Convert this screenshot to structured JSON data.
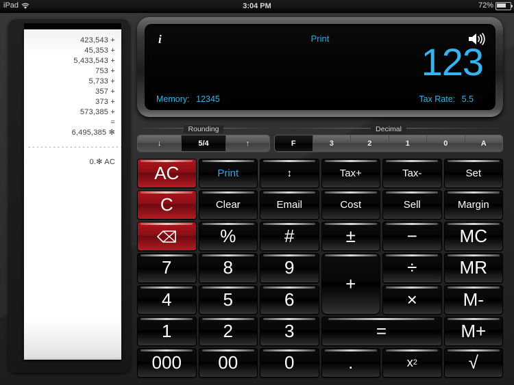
{
  "status_bar": {
    "carrier": "iPad",
    "wifi_icon": "wifi-icon",
    "time": "3:04 PM",
    "battery_percent": "72%",
    "battery_icon": "battery-icon"
  },
  "tape": {
    "lines": [
      "423,543 +",
      "45,353 +",
      "5,433,543 +",
      "753 +",
      "5,733 +",
      "357 +",
      "373 +",
      "573,385 +",
      "=",
      "6,495,385 ✻"
    ],
    "divider": "- - - - - - - - - - - - - - - - - - - - - - - -",
    "footer": "0.✻ AC"
  },
  "display": {
    "info_icon": "info-icon",
    "print_label": "Print",
    "speaker_icon": "speaker-icon",
    "value": "123",
    "memory_label": "Memory:",
    "memory_value": "12345",
    "tax_rate_label": "Tax Rate:",
    "tax_rate_value": "5.5",
    "accent_color": "#34b4f0"
  },
  "segments": {
    "rounding": {
      "title": "Rounding",
      "options": [
        {
          "label": "↓",
          "selected": false
        },
        {
          "label": "5/4",
          "selected": true
        },
        {
          "label": "↑",
          "selected": false
        }
      ]
    },
    "decimal": {
      "title": "Decimal",
      "options": [
        {
          "label": "F",
          "selected": true
        },
        {
          "label": "3",
          "selected": false
        },
        {
          "label": "2",
          "selected": false
        },
        {
          "label": "1",
          "selected": false
        },
        {
          "label": "0",
          "selected": false
        },
        {
          "label": "A",
          "selected": false
        }
      ]
    }
  },
  "keys": {
    "ac": "AC",
    "print": "Print",
    "swap": "↕",
    "tax_plus": "Tax+",
    "tax_minus": "Tax-",
    "set": "Set",
    "c": "C",
    "clear": "Clear",
    "email": "Email",
    "cost": "Cost",
    "sell": "Sell",
    "margin": "Margin",
    "backspace_icon": "backspace-icon",
    "percent": "%",
    "hash": "#",
    "plus_minus": "±",
    "minus": "−",
    "mc": "MC",
    "seven": "7",
    "eight": "8",
    "nine": "9",
    "plus": "+",
    "divide": "÷",
    "mr": "MR",
    "four": "4",
    "five": "5",
    "six": "6",
    "multiply": "×",
    "m_minus": "M-",
    "one": "1",
    "two": "2",
    "three": "3",
    "equals": "=",
    "m_plus": "M+",
    "triple_zero": "000",
    "double_zero": "00",
    "zero": "0",
    "decimal_point": ".",
    "square": "x",
    "square_exp": "2",
    "sqrt": "√"
  }
}
